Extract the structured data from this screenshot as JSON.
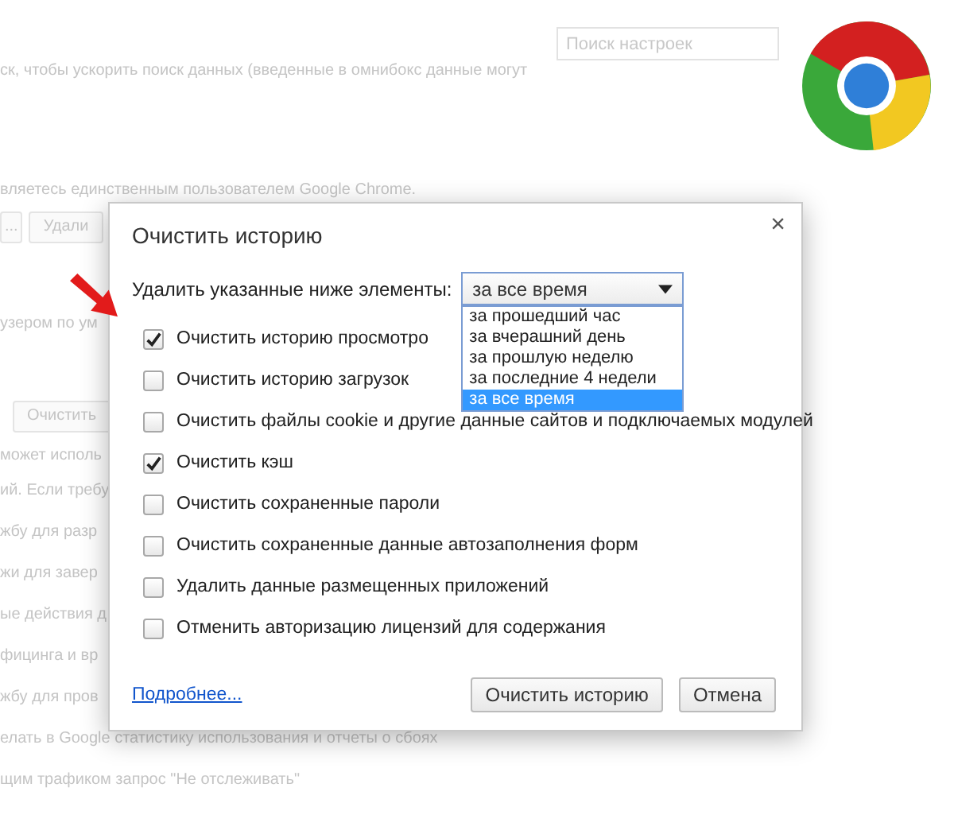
{
  "background_page": {
    "search": {
      "placeholder": "Поиск настроек"
    },
    "lines": [
      {
        "kind": "text",
        "text": "ск, чтобы ускорить поиск данных (введенные в омнибокс данные могут"
      },
      {
        "kind": "text",
        "text": "вляетесь единственным пользователем Google Chrome."
      },
      {
        "kind": "buttons",
        "labels": [
          "...",
          "Удали"
        ]
      },
      {
        "kind": "text",
        "text": "узером по ум"
      },
      {
        "kind": "buttons",
        "labels": [
          "Очистить"
        ]
      },
      {
        "kind": "text",
        "text": "может исполь"
      },
      {
        "kind": "text",
        "text": "ий. Если требу"
      },
      {
        "kind": "text",
        "text": "жбу для разр"
      },
      {
        "kind": "text",
        "text": "жи для завер"
      },
      {
        "kind": "text",
        "text": "ые действия д"
      },
      {
        "kind": "text",
        "text": "фицинга и вр"
      },
      {
        "kind": "text",
        "text": "жбу для пров"
      },
      {
        "kind": "text",
        "text": "елать в Google статистику использования и отчеты о сбоях"
      },
      {
        "kind": "text",
        "text": "щим трафиком запрос \"Не отслеживать\""
      }
    ]
  },
  "dialog": {
    "title": "Очистить историю",
    "close": "×",
    "range_label": "Удалить указанные ниже элементы:",
    "range_select": {
      "value": "за все время",
      "expanded": true,
      "options": [
        {
          "label": "за прошедший час",
          "selected": false
        },
        {
          "label": "за вчерашний день",
          "selected": false
        },
        {
          "label": "за прошлую неделю",
          "selected": false
        },
        {
          "label": "за последние 4 недели",
          "selected": false
        },
        {
          "label": "за все время",
          "selected": true
        }
      ]
    },
    "items": [
      {
        "label": "Очистить историю просмотро",
        "checked": true
      },
      {
        "label": "Очистить историю загрузок",
        "checked": false
      },
      {
        "label": "Очистить файлы cookie и другие данные сайтов и подключаемых модулей",
        "checked": false
      },
      {
        "label": "Очистить кэш",
        "checked": true
      },
      {
        "label": "Очистить сохраненные пароли",
        "checked": false
      },
      {
        "label": "Очистить сохраненные данные автозаполнения форм",
        "checked": false
      },
      {
        "label": "Удалить данные размещенных приложений",
        "checked": false
      },
      {
        "label": "Отменить авторизацию лицензий для содержания",
        "checked": false
      }
    ],
    "more_link": "Подробнее...",
    "buttons": [
      "Очистить историю",
      "Отмена"
    ]
  }
}
